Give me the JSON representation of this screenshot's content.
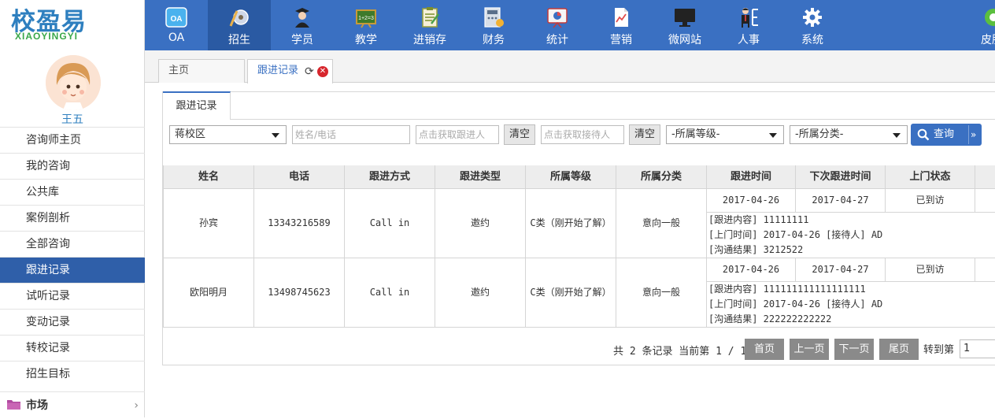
{
  "brand": {
    "name_cn": "校盈易",
    "name_en": "XIAOYINGYI"
  },
  "user": {
    "name": "王五"
  },
  "sidebar": {
    "items": [
      {
        "label": "咨询师主页"
      },
      {
        "label": "我的咨询"
      },
      {
        "label": "公共库"
      },
      {
        "label": "案例剖析"
      },
      {
        "label": "全部咨询"
      },
      {
        "label": "跟进记录"
      },
      {
        "label": "试听记录"
      },
      {
        "label": "变动记录"
      },
      {
        "label": "转校记录"
      },
      {
        "label": "招生目标"
      }
    ],
    "active_index": 5,
    "section": {
      "label": "市场",
      "chevron": "›"
    }
  },
  "topnav": {
    "items": [
      {
        "label": "OA",
        "icon": "oa-icon"
      },
      {
        "label": "招生",
        "icon": "recruit-icon"
      },
      {
        "label": "学员",
        "icon": "student-icon"
      },
      {
        "label": "教学",
        "icon": "teaching-board-icon"
      },
      {
        "label": "进销存",
        "icon": "clipboard-icon"
      },
      {
        "label": "财务",
        "icon": "finance-icon"
      },
      {
        "label": "统计",
        "icon": "statistics-icon"
      },
      {
        "label": "营销",
        "icon": "marketing-icon"
      },
      {
        "label": "微网站",
        "icon": "monitor-icon"
      },
      {
        "label": "人事",
        "icon": "personnel-icon"
      },
      {
        "label": "系统",
        "icon": "gear-icon"
      },
      {
        "label": "皮肤",
        "icon": "skin-icon"
      }
    ],
    "active_index": 1,
    "colors": {
      "bar": "#3a70c2",
      "active": "#2a5aa3"
    }
  },
  "pagetabs": [
    {
      "label": "主页"
    },
    {
      "label": "跟进记录"
    }
  ],
  "subtab": {
    "label": "跟进记录"
  },
  "filters": {
    "campus": "蒋校区",
    "name_phone_placeholder": "姓名/电话",
    "follower_placeholder": "点击获取跟进人",
    "clear_label": "清空",
    "receiver_placeholder": "点击获取接待人",
    "level": "-所属等级-",
    "category": "-所属分类-",
    "query_label": "查询",
    "more_icon": "»"
  },
  "table": {
    "headers": [
      "姓名",
      "电话",
      "跟进方式",
      "跟进类型",
      "所属等级",
      "所属分类",
      "跟进时间",
      "下次跟进时间",
      "上门状态"
    ],
    "rows": [
      {
        "name": "孙宾",
        "phone": "13343216589",
        "method": "Call in",
        "type": "邀约",
        "level": "C类（刚开始了解）",
        "category": "意向一般",
        "follow_time": "2017-04-26",
        "next_time": "2017-04-27",
        "visit_status": "已到访",
        "detail": [
          "[跟进内容] 11111111",
          "[上门时间] 2017-04-26 [接待人] AD",
          "[沟通结果] 3212522"
        ]
      },
      {
        "name": "欧阳明月",
        "phone": "13498745623",
        "method": "Call in",
        "type": "邀约",
        "level": "C类（刚开始了解）",
        "category": "意向一般",
        "follow_time": "2017-04-26",
        "next_time": "2017-04-27",
        "visit_status": "已到访",
        "detail": [
          "[跟进内容] 111111111111111111",
          "[上门时间] 2017-04-26 [接待人] AD",
          "[沟通结果] 222222222222"
        ]
      }
    ]
  },
  "pager": {
    "info": "共 2 条记录 当前第 1 / 1",
    "first": "首页",
    "prev": "上一页",
    "next": "下一页",
    "last": "尾页",
    "goto_label": "转到第",
    "page_value": "1"
  }
}
